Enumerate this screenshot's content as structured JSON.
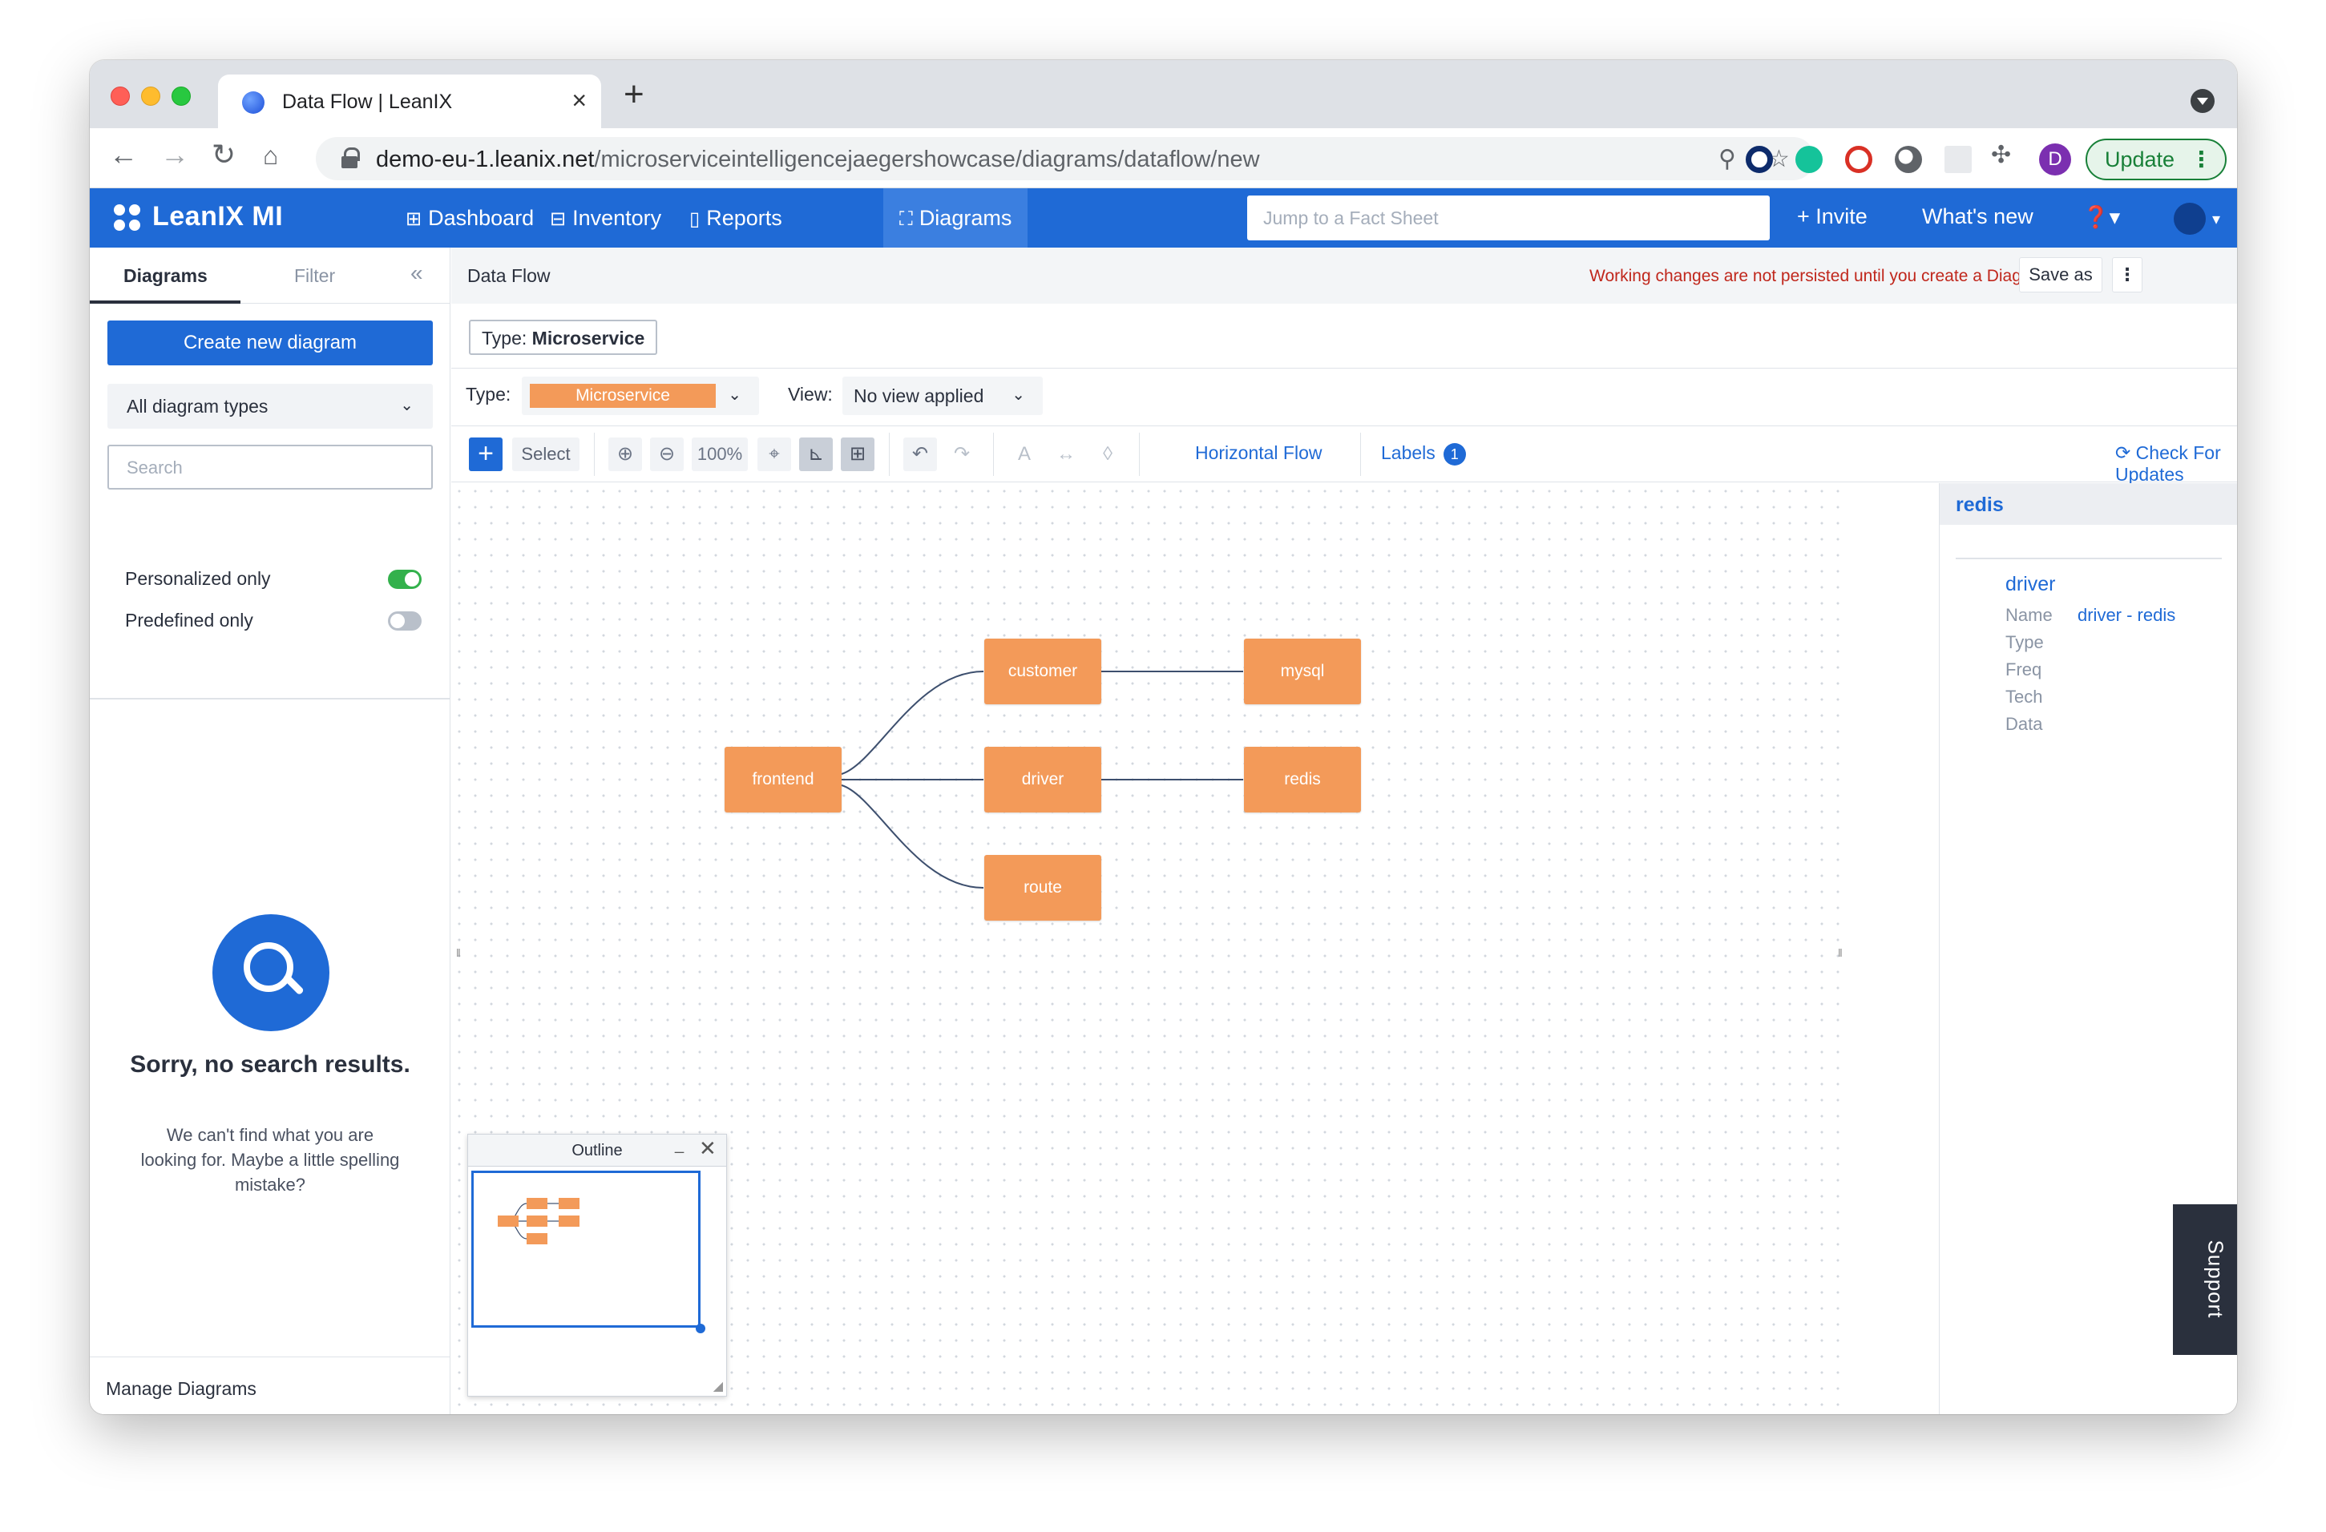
{
  "browser": {
    "tab_title": "Data Flow | LeanIX",
    "url_host": "demo-eu-1.leanix.net",
    "url_path": "/microserviceintelligencejaegershowcase/diagrams/dataflow/new",
    "profile_initial": "D",
    "update_label": "Update",
    "update_menu": "⋮"
  },
  "header": {
    "logo": "LeanIX MI",
    "nav": [
      {
        "label": "Dashboard",
        "icon": "grid-icon"
      },
      {
        "label": "Inventory",
        "icon": "inventory-icon"
      },
      {
        "label": "Reports",
        "icon": "reports-icon"
      },
      {
        "label": "Diagrams",
        "icon": "diagrams-icon",
        "active": true
      }
    ],
    "jump_placeholder": "Jump to a Fact Sheet",
    "invite": "+ Invite",
    "whats_new": "What's new"
  },
  "sidebar": {
    "tab_diagrams": "Diagrams",
    "tab_filter": "Filter",
    "create_label": "Create new diagram",
    "types_select": "All diagram types",
    "search_placeholder": "Search",
    "toggles": [
      {
        "label": "Personalized only",
        "on": true
      },
      {
        "label": "Predefined only",
        "on": false
      }
    ],
    "empty_title": "Sorry, no search results.",
    "empty_text": "We can't find what you are looking for. Maybe a little spelling mistake?",
    "manage_label": "Manage Diagrams"
  },
  "main": {
    "title": "Data Flow",
    "warning": "Working changes are not persisted until you create a Diagram!",
    "save_as": "Save as",
    "more": "⋮",
    "type_chip_prefix": "Type:",
    "type_chip_value": "Microservice",
    "type_label": "Type:",
    "type_value": "Microservice",
    "view_label": "View:",
    "view_value": "No view applied"
  },
  "toolbar": {
    "add": "+",
    "select": "Select",
    "zoom": "100%",
    "horizontal_flow": "Horizontal Flow",
    "labels": "Labels",
    "labels_count": "1",
    "check_updates": "Check For Updates"
  },
  "diagram": {
    "nodes": {
      "frontend": "frontend",
      "customer": "customer",
      "driver": "driver",
      "route": "route",
      "mysql": "mysql",
      "redis": "redis"
    },
    "edges": [
      [
        "frontend",
        "customer"
      ],
      [
        "frontend",
        "driver"
      ],
      [
        "frontend",
        "route"
      ],
      [
        "customer",
        "mysql"
      ],
      [
        "driver",
        "redis"
      ]
    ]
  },
  "outline": {
    "title": "Outline",
    "minimize": "_",
    "close": "✕"
  },
  "properties": {
    "selected": "redis",
    "section": "driver",
    "fields": [
      {
        "label": "Name",
        "value": "driver - redis"
      },
      {
        "label": "Type",
        "value": ""
      },
      {
        "label": "Freq",
        "value": ""
      },
      {
        "label": "Tech",
        "value": ""
      },
      {
        "label": "Data",
        "value": ""
      }
    ]
  },
  "support": "Support",
  "colors": {
    "brand": "#1f6ad6",
    "node": "#f39a59",
    "warning": "#c0271c"
  }
}
